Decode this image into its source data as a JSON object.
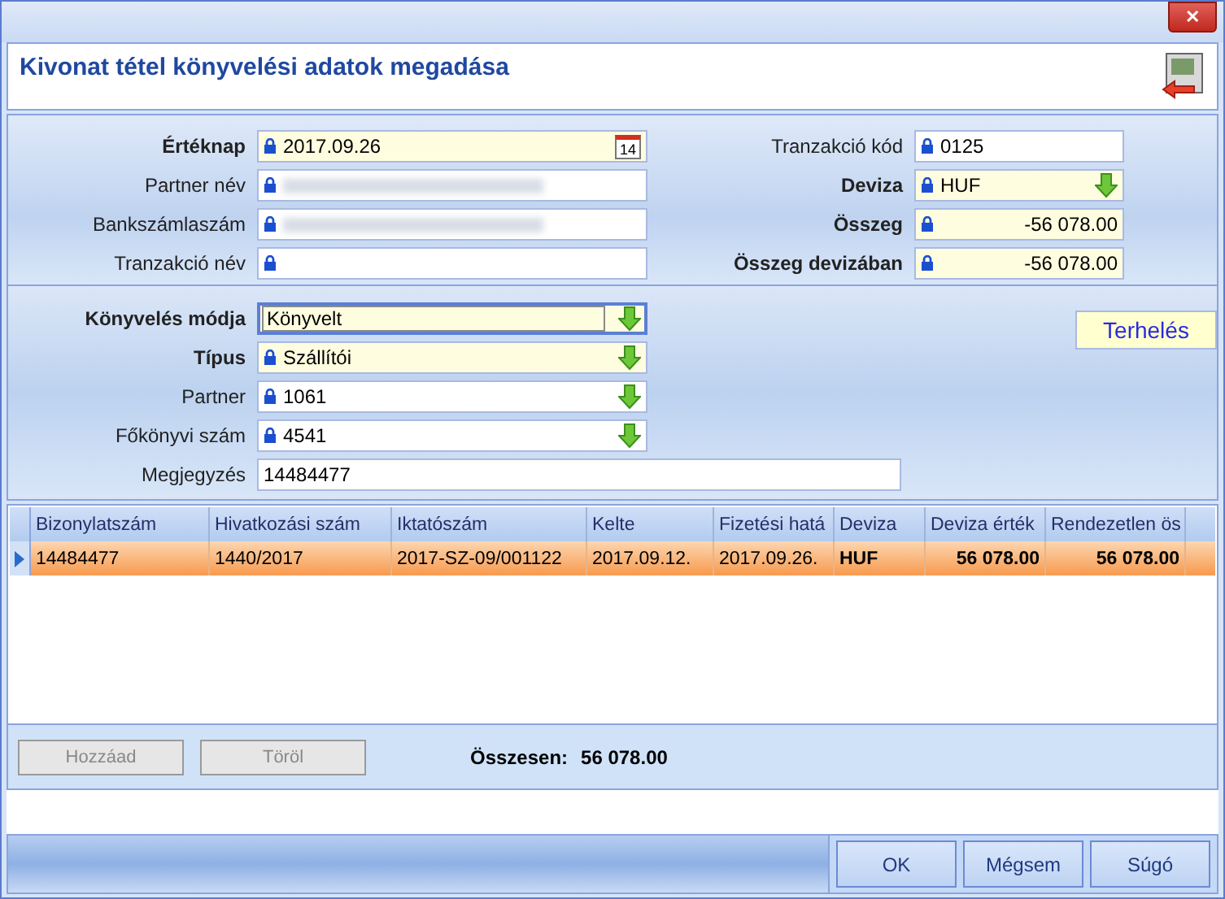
{
  "window": {
    "title": "Kivonat tétel könyvelési adatok megadása",
    "close": "✕"
  },
  "left_fields": [
    {
      "label": "Értéknap",
      "bold": true,
      "kind": "date",
      "locked": true,
      "highlighted": true,
      "value": "2017.09.26",
      "calendar_day": "14"
    },
    {
      "label": "Partner név",
      "bold": false,
      "kind": "redacted",
      "locked": true,
      "highlighted": false
    },
    {
      "label": "Bankszámlaszám",
      "bold": false,
      "kind": "redacted",
      "locked": true,
      "highlighted": false
    },
    {
      "label": "Tranzakció név",
      "bold": false,
      "kind": "text",
      "locked": true,
      "highlighted": false
    }
  ],
  "right_fields": [
    {
      "label": "Tranzakció kód",
      "bold": false,
      "kind": "text",
      "locked": true,
      "highlighted": false,
      "value": "0125"
    },
    {
      "label": "Deviza",
      "bold": true,
      "kind": "dropdown",
      "locked": true,
      "highlighted": true,
      "value": "HUF"
    },
    {
      "label": "Összeg",
      "bold": true,
      "kind": "amount",
      "locked": true,
      "highlighted": true,
      "value": "-56 078.00"
    },
    {
      "label": "Összeg devizában",
      "bold": true,
      "kind": "amount",
      "locked": true,
      "highlighted": true,
      "value": "-56 078.00"
    }
  ],
  "booking_fields": [
    {
      "label": "Könyvelés módja",
      "bold": true,
      "kind": "dropdown",
      "locked": false,
      "highlighted": true,
      "focused": true,
      "value": "Könyvelt"
    },
    {
      "label": "Típus",
      "bold": true,
      "kind": "dropdown",
      "locked": true,
      "highlighted": true,
      "focused": false,
      "value": "Szállítói"
    },
    {
      "label": "Partner",
      "bold": false,
      "kind": "dropdown",
      "locked": true,
      "highlighted": false,
      "focused": false,
      "value": "1061"
    },
    {
      "label": "Főkönyvi szám",
      "bold": false,
      "kind": "dropdown",
      "locked": true,
      "highlighted": false,
      "focused": false,
      "value": "4541"
    },
    {
      "label": "Megjegyzés",
      "bold": false,
      "kind": "wide",
      "locked": false,
      "highlighted": false,
      "focused": false,
      "value": "14484477"
    }
  ],
  "direction_badge": "Terhelés",
  "table": {
    "columns": [
      "Bizonylatszám",
      "Hivatkozási szám",
      "Iktatószám",
      "Kelte",
      "Fizetési hatá",
      "Deviza",
      "Deviza érték",
      "Rendezetlen ös"
    ],
    "rows": [
      {
        "selected": true,
        "cells": [
          "14484477",
          "1440/2017",
          "2017-SZ-09/001122",
          "2017.09.12.",
          "2017.09.26.",
          "HUF",
          "56 078.00",
          "56 078.00"
        ]
      }
    ]
  },
  "actions": [
    {
      "label": "Hozzáad",
      "disabled": true
    },
    {
      "label": "Töröl",
      "disabled": true
    }
  ],
  "total": {
    "label": "Összesen:",
    "value": "56 078.00"
  },
  "footer_buttons": [
    {
      "label": "OK",
      "disabled": false
    },
    {
      "label": "Mégsem",
      "disabled": false
    },
    {
      "label": "Súgó",
      "disabled": false
    }
  ]
}
